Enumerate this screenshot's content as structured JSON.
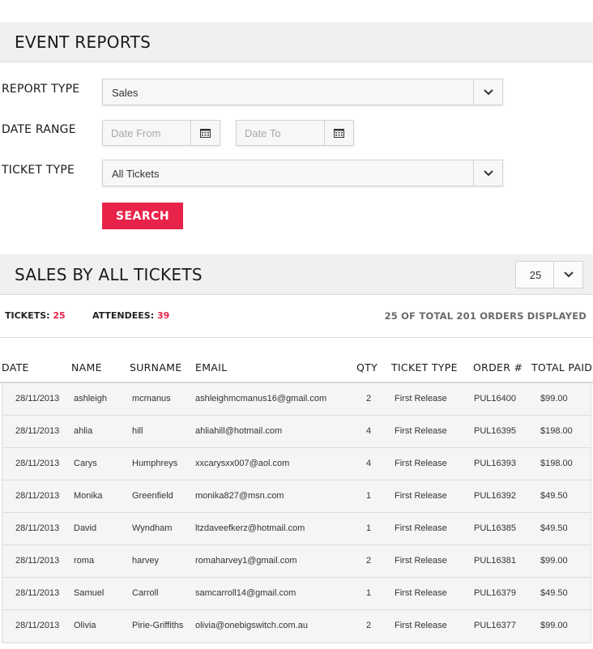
{
  "reports": {
    "title": "EVENT REPORTS",
    "report_type_label": "REPORT TYPE",
    "report_type_value": "Sales",
    "date_range_label": "DATE RANGE",
    "date_from_placeholder": "Date From",
    "date_to_placeholder": "Date To",
    "ticket_type_label": "TICKET TYPE",
    "ticket_type_value": "All Tickets",
    "search_label": "SEARCH"
  },
  "sales": {
    "title": "SALES BY ALL TICKETS",
    "per_page": "25",
    "tickets_label": "TICKETS:",
    "tickets_value": "25",
    "attendees_label": "ATTENDEES:",
    "attendees_value": "39",
    "orders_info": "25 OF TOTAL 201 ORDERS DISPLAYED"
  },
  "table": {
    "headers": [
      "DATE",
      "NAME",
      "SURNAME",
      "EMAIL",
      "QTY",
      "TICKET TYPE",
      "ORDER #",
      "TOTAL PAID"
    ],
    "rows": [
      [
        "28/11/2013",
        "ashleigh",
        "mcmanus",
        "ashleighmcmanus16@gmail.com",
        "2",
        "First Release",
        "PUL16400",
        "$99.00"
      ],
      [
        "28/11/2013",
        "ahlia",
        "hill",
        "ahliahill@hotmail.com",
        "4",
        "First Release",
        "PUL16395",
        "$198.00"
      ],
      [
        "28/11/2013",
        "Carys",
        "Humphreys",
        "xxcarysxx007@aol.com",
        "4",
        "First Release",
        "PUL16393",
        "$198.00"
      ],
      [
        "28/11/2013",
        "Monika",
        "Greenfield",
        "monika827@msn.com",
        "1",
        "First Release",
        "PUL16392",
        "$49.50"
      ],
      [
        "28/11/2013",
        "David",
        "Wyndham",
        "ltzdaveefkerz@hotmail.com",
        "1",
        "First Release",
        "PUL16385",
        "$49.50"
      ],
      [
        "28/11/2013",
        "roma",
        "harvey",
        "romaharvey1@gmail.com",
        "2",
        "First Release",
        "PUL16381",
        "$99.00"
      ],
      [
        "28/11/2013",
        "Samuel",
        "Carroll",
        "samcarroll14@gmail.com",
        "1",
        "First Release",
        "PUL16379",
        "$49.50"
      ],
      [
        "28/11/2013",
        "Olivia",
        "Pirie-Griffiths",
        "olivia@onebigswitch.com.au",
        "2",
        "First Release",
        "PUL16377",
        "$99.00"
      ]
    ]
  },
  "icons": {
    "select_arrow": "chevron-down-icon",
    "calendar": "calendar-icon"
  },
  "colors": {
    "accent": "#e8234a",
    "bar_bg": "#f0f0f0",
    "row_bg": "#f5f5f5"
  }
}
